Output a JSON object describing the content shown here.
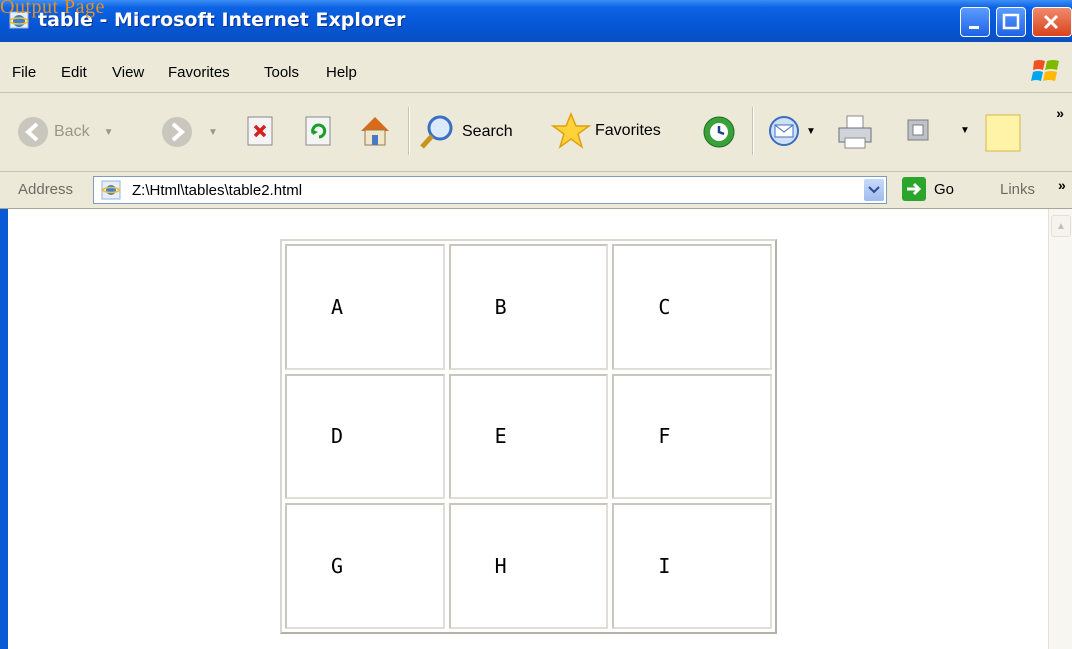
{
  "window": {
    "title": "table - Microsoft Internet Explorer"
  },
  "overlay_text": "Output Page",
  "menu": [
    "File",
    "Edit",
    "View",
    "Favorites",
    "Tools",
    "Help"
  ],
  "toolbar": {
    "back": "Back",
    "search": "Search",
    "favorites": "Favorites"
  },
  "address": {
    "label": "Address",
    "value": "Z:\\Html\\tables\\table2.html",
    "go": "Go",
    "links": "Links"
  },
  "table": {
    "rows": [
      [
        "A",
        "B",
        "C"
      ],
      [
        "D",
        "E",
        "F"
      ],
      [
        "G",
        "H",
        "I"
      ]
    ]
  },
  "colors": {
    "titlebar": "#0656d6",
    "chrome": "#ece9d8",
    "overlay": "#e8901c"
  }
}
